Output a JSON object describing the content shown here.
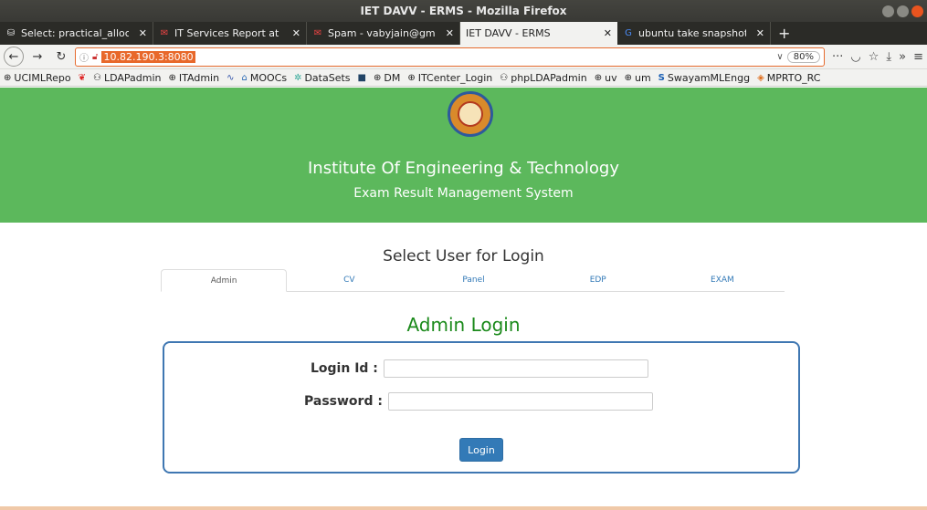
{
  "window": {
    "title": "IET DAVV - ERMS - Mozilla Firefox"
  },
  "tabs": [
    {
      "label": "Select: practical_allocat",
      "icon": "database-icon"
    },
    {
      "label": "IT Services Report at IET",
      "icon": "gmail-icon"
    },
    {
      "label": "Spam - vabyjain@gmail.c",
      "icon": "gmail-icon"
    },
    {
      "label": "IET DAVV - ERMS",
      "icon": ""
    },
    {
      "label": "ubuntu take snapshot - C",
      "icon": "google-icon"
    }
  ],
  "navbar": {
    "url": "10.82.190.3:8080",
    "zoom": "80%"
  },
  "bookmarks": [
    {
      "label": "UCIMLRepo",
      "icon": "globe-icon"
    },
    {
      "label": "",
      "icon": "flame-icon"
    },
    {
      "label": "LDAPadmin",
      "icon": "ldap-icon"
    },
    {
      "label": "ITAdmin",
      "icon": "globe-icon"
    },
    {
      "label": "",
      "icon": "wave-icon"
    },
    {
      "label": "MOOCs",
      "icon": "mooc-icon"
    },
    {
      "label": "DataSets",
      "icon": "dataset-icon"
    },
    {
      "label": "",
      "icon": "square-icon"
    },
    {
      "label": "DM",
      "icon": "globe-icon"
    },
    {
      "label": "ITCenter_Login",
      "icon": "globe-icon"
    },
    {
      "label": "phpLDAPadmin",
      "icon": "ldap-icon"
    },
    {
      "label": "uv",
      "icon": "globe-icon"
    },
    {
      "label": "um",
      "icon": "globe-icon"
    },
    {
      "label": "SwayamMLEngg",
      "icon": "swayam-icon"
    },
    {
      "label": "MPRTO_RC",
      "icon": "diamond-icon"
    }
  ],
  "header": {
    "institute": "Institute Of Engineering & Technology",
    "system": "Exam Result Management System"
  },
  "login": {
    "select_title": "Select User for Login",
    "user_tabs": [
      "Admin",
      "CV",
      "Panel",
      "EDP",
      "EXAM"
    ],
    "heading": "Admin Login",
    "login_id_label": "Login Id :",
    "password_label": "Password :",
    "button": "Login"
  },
  "colors": {
    "header_bg": "#5cb85c",
    "heading": "#1b8a1b",
    "box_border": "#3f77b2",
    "button": "#337ab7"
  }
}
